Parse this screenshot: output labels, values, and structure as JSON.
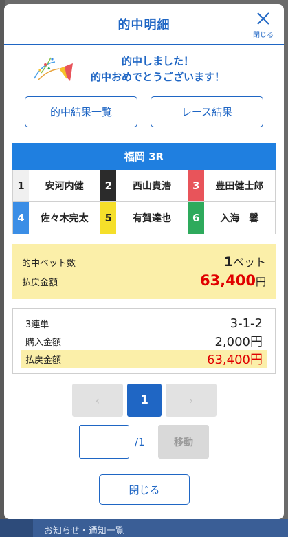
{
  "modal": {
    "title": "的中明細",
    "close_label": "閉じる",
    "congrats_line1": "的中しました！",
    "congrats_line2": "的中おめでとうございます！"
  },
  "links": {
    "hit_results": "的中結果一覧",
    "race_results": "レース結果"
  },
  "race": {
    "title": "福岡 3R",
    "runners": [
      {
        "num": "1",
        "name": "安河内健",
        "bg": "#f0f0f0",
        "fg": "#222222"
      },
      {
        "num": "2",
        "name": "西山貴浩",
        "bg": "#2b2b2b",
        "fg": "#ffffff"
      },
      {
        "num": "3",
        "name": "豊田健士郎",
        "bg": "#e8545a",
        "fg": "#ffffff"
      },
      {
        "num": "4",
        "name": "佐々木完太",
        "bg": "#3b8ee6",
        "fg": "#ffffff"
      },
      {
        "num": "5",
        "name": "有賀達也",
        "bg": "#f5df2a",
        "fg": "#222222"
      },
      {
        "num": "6",
        "name": "入海　馨",
        "bg": "#2eaa5c",
        "fg": "#ffffff"
      }
    ]
  },
  "summary": {
    "bet_count_label": "的中ベット数",
    "bet_count": "1",
    "bet_unit": "ベット",
    "payout_label": "払戻金額",
    "payout": "63,400",
    "yen": "円"
  },
  "detail": {
    "bet_type": "3連単",
    "combination": "3-1-2",
    "purchase_label": "購入金額",
    "purchase": "2,000円",
    "payout_label": "払戻金額",
    "payout": "63,400円"
  },
  "pager": {
    "prev": "‹",
    "current": "1",
    "next": "›",
    "input_value": "",
    "total": "/1",
    "move_label": "移動"
  },
  "footer": {
    "close_label": "閉じる",
    "background_text": "お知らせ・通知一覧"
  },
  "colors": {
    "primary": "#1f66c4",
    "race_header": "#1f7fe0",
    "highlight": "#fbefa9",
    "payout_red": "#e00000"
  }
}
